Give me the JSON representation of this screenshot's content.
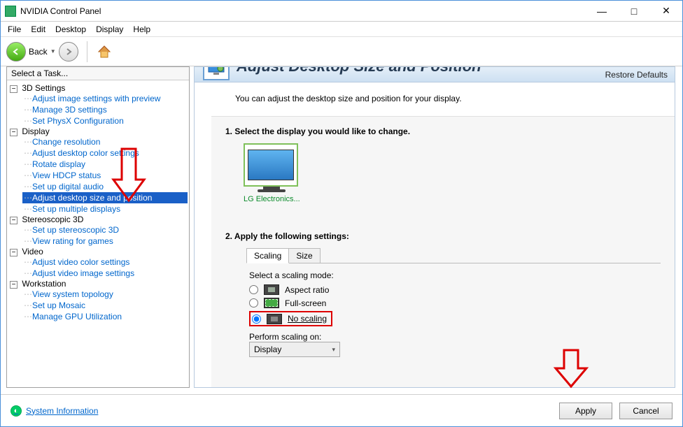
{
  "titlebar": {
    "title": "NVIDIA Control Panel"
  },
  "menu": {
    "file": "File",
    "edit": "Edit",
    "desktop": "Desktop",
    "display": "Display",
    "help": "Help"
  },
  "toolbar": {
    "back": "Back"
  },
  "sidebar": {
    "header": "Select a Task...",
    "groups": [
      {
        "label": "3D Settings",
        "items": [
          "Adjust image settings with preview",
          "Manage 3D settings",
          "Set PhysX Configuration"
        ]
      },
      {
        "label": "Display",
        "items": [
          "Change resolution",
          "Adjust desktop color settings",
          "Rotate display",
          "View HDCP status",
          "Set up digital audio",
          "Adjust desktop size and position",
          "Set up multiple displays"
        ]
      },
      {
        "label": "Stereoscopic 3D",
        "items": [
          "Set up stereoscopic 3D",
          "View rating for games"
        ]
      },
      {
        "label": "Video",
        "items": [
          "Adjust video color settings",
          "Adjust video image settings"
        ]
      },
      {
        "label": "Workstation",
        "items": [
          "View system topology",
          "Set up Mosaic",
          "Manage GPU Utilization"
        ]
      }
    ]
  },
  "content": {
    "big_title": "Adjust Desktop Size and Position",
    "restore": "Restore Defaults",
    "desc": "You can adjust the desktop size and position for your display.",
    "step1": "1. Select the display you would like to change.",
    "monitor_label": "LG Electronics...",
    "step2": "2. Apply the following settings:",
    "tabs": {
      "scaling": "Scaling",
      "size": "Size"
    },
    "scaling": {
      "prompt": "Select a scaling mode:",
      "opt_aspect": "Aspect ratio",
      "opt_full": "Full-screen",
      "opt_none": "No scaling",
      "perform_label": "Perform scaling on:",
      "perform_value": "Display"
    }
  },
  "footer": {
    "sysinfo": "System Information",
    "apply": "Apply",
    "cancel": "Cancel"
  }
}
